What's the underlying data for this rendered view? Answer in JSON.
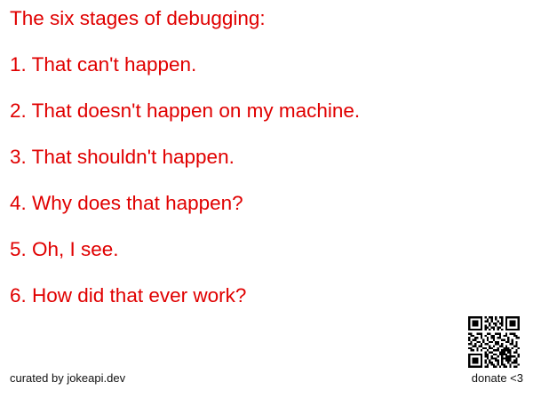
{
  "joke": {
    "lines": [
      "The six stages of debugging:",
      "1. That can't happen.",
      "2. That doesn't happen on my machine.",
      "3. That shouldn't happen.",
      "4. Why does that happen?",
      "5. Oh, I see.",
      "6. How did that ever work?"
    ]
  },
  "footer": {
    "credit": "curated by jokeapi.dev",
    "donate": "donate <3"
  },
  "colors": {
    "text": "#e00000",
    "footer_text": "#111111",
    "background": "#ffffff"
  },
  "icons": {
    "qr": "qr-code-icon"
  }
}
